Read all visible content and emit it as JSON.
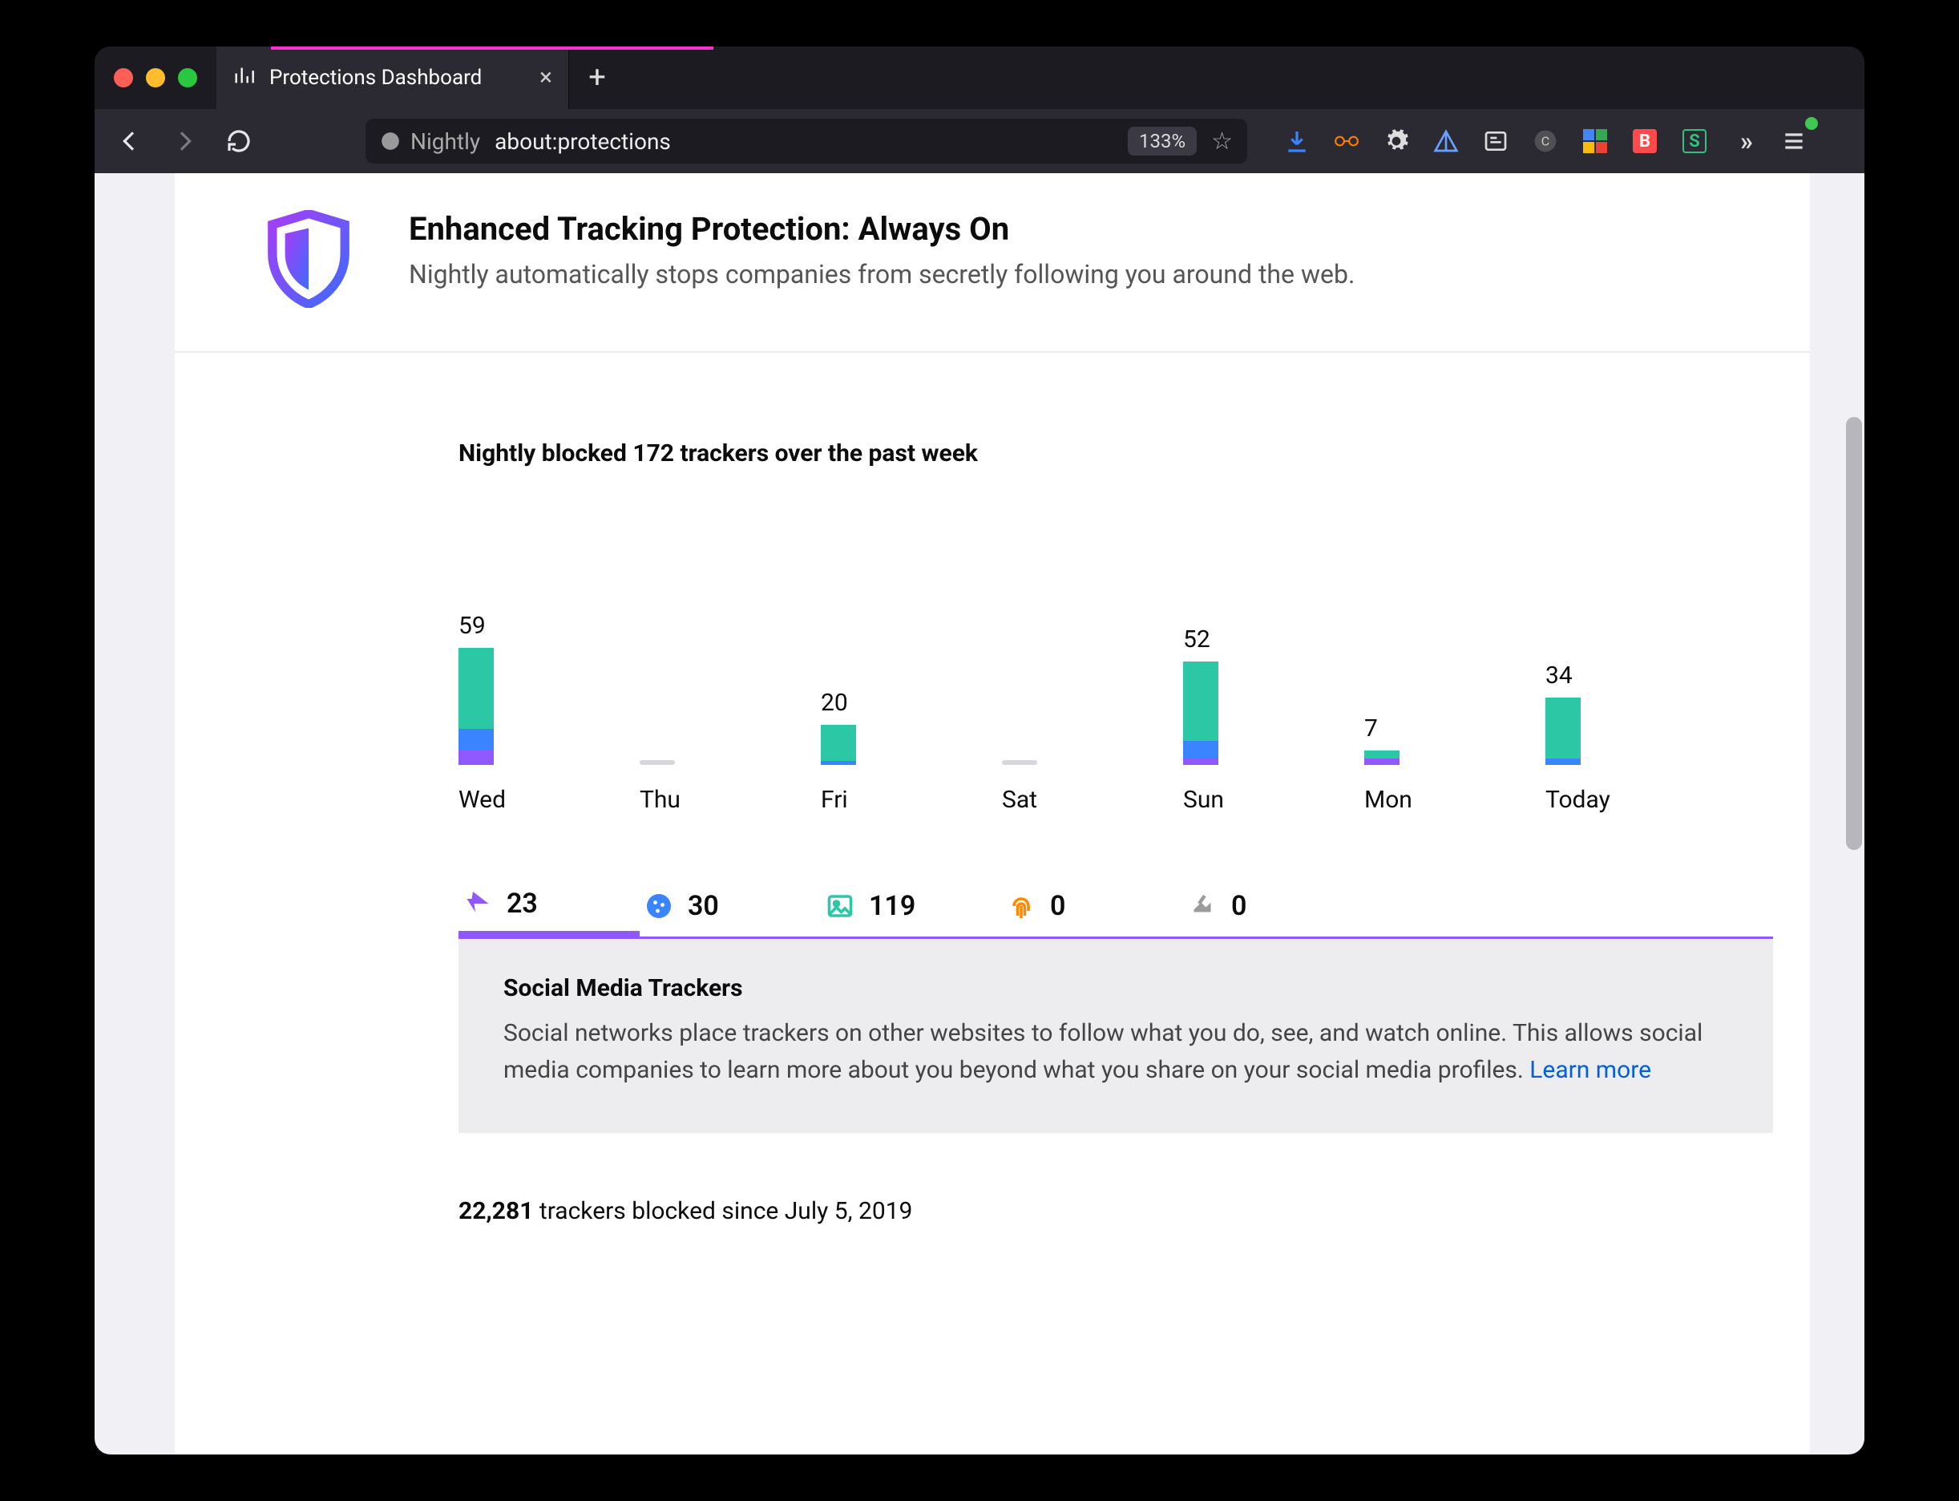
{
  "window": {
    "tab_title": "Protections Dashboard"
  },
  "urlbar": {
    "identity_label": "Nightly",
    "url": "about:protections",
    "zoom": "133%"
  },
  "header": {
    "title": "Enhanced Tracking Protection: Always On",
    "subtitle": "Nightly automatically stops companies from secretly following you around the web."
  },
  "week_title": "Nightly blocked 172 trackers over the past week",
  "tabs_bar": {
    "social": "23",
    "cookies": "30",
    "content": "119",
    "fingerprint": "0",
    "cryptominer": "0"
  },
  "info": {
    "heading": "Social Media Trackers",
    "body": "Social networks place trackers on other websites to follow what you do, see, and watch online. This allows social media companies to learn more about you beyond what you share on your social media profiles. ",
    "link": "Learn more"
  },
  "total": {
    "count": "22,281",
    "text": " trackers blocked since July 5, 2019"
  },
  "chart_data": {
    "type": "bar",
    "categories": [
      "Wed",
      "Thu",
      "Fri",
      "Sat",
      "Sun",
      "Mon",
      "Today"
    ],
    "values": [
      59,
      0,
      20,
      0,
      52,
      7,
      34
    ],
    "title": "Nightly blocked 172 trackers over the past week",
    "ylim": [
      0,
      60
    ],
    "series": [
      {
        "name": "tracking-content",
        "color": "#2cc8a5",
        "values": [
          41,
          0,
          18,
          0,
          40,
          4,
          31
        ]
      },
      {
        "name": "cookies",
        "color": "#3a84ff",
        "values": [
          11,
          0,
          2,
          0,
          9,
          0,
          3
        ]
      },
      {
        "name": "social",
        "color": "#9059ff",
        "values": [
          7,
          0,
          0,
          0,
          3,
          3,
          0
        ]
      }
    ]
  }
}
